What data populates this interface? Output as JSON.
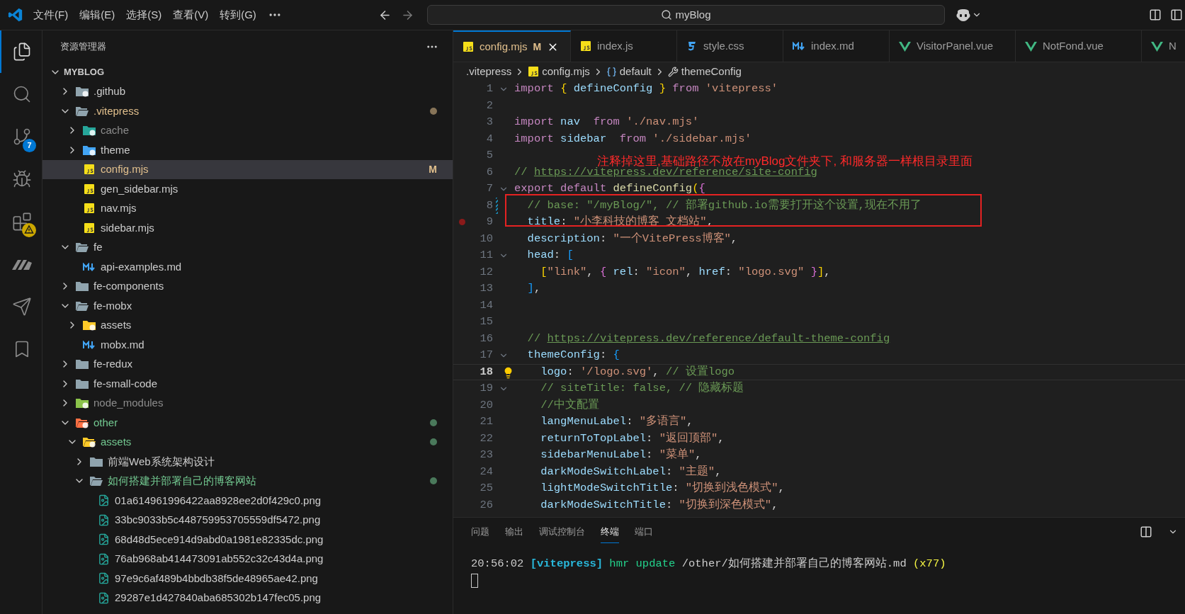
{
  "menu": [
    "文件(F)",
    "编辑(E)",
    "选择(S)",
    "查看(V)",
    "转到(G)"
  ],
  "command_center": {
    "text": "myBlog"
  },
  "activity_bar": [
    {
      "kind": "files",
      "selected": true
    },
    {
      "kind": "search",
      "selected": false
    },
    {
      "kind": "scm",
      "selected": false,
      "badge": "7"
    },
    {
      "kind": "run",
      "selected": false
    },
    {
      "kind": "extensions",
      "selected": false,
      "warning": true
    },
    {
      "kind": "bars",
      "selected": false
    },
    {
      "kind": "send",
      "selected": false
    },
    {
      "kind": "bookmark",
      "selected": false
    }
  ],
  "sidebar": {
    "title": "资源管理器",
    "root": {
      "name": "MYBLOG",
      "expanded": true
    },
    "tree": [
      {
        "name": ".github",
        "kind": "github",
        "color": "#cccccc",
        "expanded": false,
        "selected": false,
        "dot": false
      },
      {
        "name": ".vitepress",
        "kind": "folder",
        "color": "#e2c08d",
        "expanded": true,
        "selected": false,
        "dot": true,
        "children": [
          {
            "name": "cache",
            "kind": "cache",
            "color": "#8c8c8c",
            "expanded": false,
            "selected": false,
            "dot": false
          },
          {
            "name": "theme",
            "kind": "theme",
            "color": "#cccccc",
            "expanded": false,
            "selected": false,
            "dot": false
          },
          {
            "name": "config.mjs",
            "kind": "js",
            "color": "#e2c08d",
            "selected": true,
            "dot": false,
            "badge": "M"
          },
          {
            "name": "gen_sidebar.mjs",
            "kind": "js",
            "color": "#cccccc",
            "selected": false,
            "dot": false
          },
          {
            "name": "nav.mjs",
            "kind": "js",
            "color": "#cccccc",
            "selected": false,
            "dot": false
          },
          {
            "name": "sidebar.mjs",
            "kind": "js",
            "color": "#cccccc",
            "selected": false,
            "dot": false
          }
        ]
      },
      {
        "name": "fe",
        "kind": "folder",
        "color": "#cccccc",
        "expanded": true,
        "selected": false,
        "dot": false,
        "children": [
          {
            "name": "api-examples.md",
            "kind": "md",
            "color": "#cccccc",
            "selected": false,
            "dot": false
          }
        ]
      },
      {
        "name": "fe-components",
        "kind": "folder",
        "color": "#cccccc",
        "expanded": false,
        "selected": false,
        "dot": false
      },
      {
        "name": "fe-mobx",
        "kind": "folder",
        "color": "#cccccc",
        "expanded": true,
        "selected": false,
        "dot": false,
        "children": [
          {
            "name": "assets",
            "kind": "assets",
            "color": "#cccccc",
            "expanded": false,
            "selected": false,
            "dot": false
          },
          {
            "name": "mobx.md",
            "kind": "md",
            "color": "#cccccc",
            "selected": false,
            "dot": false
          }
        ]
      },
      {
        "name": "fe-redux",
        "kind": "folder",
        "color": "#cccccc",
        "expanded": false,
        "selected": false,
        "dot": false
      },
      {
        "name": "fe-small-code",
        "kind": "folder",
        "color": "#cccccc",
        "expanded": false,
        "selected": false,
        "dot": false
      },
      {
        "name": "node_modules",
        "kind": "node",
        "color": "#8c8c8c",
        "expanded": false,
        "selected": false,
        "dot": false
      },
      {
        "name": "other",
        "kind": "other",
        "color": "#73c991",
        "expanded": true,
        "selected": false,
        "dot": true,
        "children": [
          {
            "name": "assets",
            "kind": "assets",
            "color": "#73c991",
            "expanded": true,
            "selected": false,
            "dot": true,
            "children": [
              {
                "name": "前端Web系统架构设计",
                "kind": "folder",
                "color": "#cccccc",
                "expanded": false,
                "selected": false,
                "dot": false
              },
              {
                "name": "如何搭建并部署自己的博客网站",
                "kind": "folder",
                "color": "#73c991",
                "expanded": true,
                "selected": false,
                "dot": true,
                "children": [
                  {
                    "name": "01a614961996422aa8928ee2d0f429c0.png",
                    "kind": "image",
                    "color": "#cccccc",
                    "selected": false,
                    "dot": false
                  },
                  {
                    "name": "33bc9033b5c448759953705559df5472.png",
                    "kind": "image",
                    "color": "#cccccc",
                    "selected": false,
                    "dot": false
                  },
                  {
                    "name": "68d48d5ece914d9abd0a1981e82335dc.png",
                    "kind": "image",
                    "color": "#cccccc",
                    "selected": false,
                    "dot": false
                  },
                  {
                    "name": "76ab968ab414473091ab552c32c43d4a.png",
                    "kind": "image",
                    "color": "#cccccc",
                    "selected": false,
                    "dot": false
                  },
                  {
                    "name": "97e9c6af489b4bbdb38f5de48965ae42.png",
                    "kind": "image",
                    "color": "#cccccc",
                    "selected": false,
                    "dot": false
                  },
                  {
                    "name": "29287e1d427840aba685302b147fec05.png",
                    "kind": "image",
                    "color": "#cccccc",
                    "selected": false,
                    "dot": false
                  }
                ]
              }
            ]
          }
        ]
      }
    ]
  },
  "tabs": [
    {
      "label": "config.mjs",
      "kind": "js",
      "selected": true,
      "badge": "M"
    },
    {
      "label": "index.js",
      "kind": "js",
      "selected": false
    },
    {
      "label": "style.css",
      "kind": "css",
      "selected": false
    },
    {
      "label": "index.md",
      "kind": "md",
      "selected": false
    },
    {
      "label": "VisitorPanel.vue",
      "kind": "vue",
      "selected": false
    },
    {
      "label": "NotFond.vue",
      "kind": "vue",
      "selected": false
    },
    {
      "label": "N",
      "kind": "vue",
      "selected": false
    }
  ],
  "breadcrumbs": [
    {
      "label": ".vitepress",
      "kind": "folder"
    },
    {
      "label": "config.mjs",
      "kind": "js"
    },
    {
      "label": "default",
      "kind": "symbol"
    },
    {
      "label": "themeConfig",
      "kind": "property"
    }
  ],
  "code": [
    {
      "n": "1",
      "fold": true,
      "modified": false,
      "breakpoint": false,
      "lightbulb": false,
      "current": false,
      "tokens": [
        {
          "kind": "kw",
          "t": "import "
        },
        {
          "kind": "b1",
          "t": "{"
        },
        {
          "kind": "id",
          "t": " defineConfig "
        },
        {
          "kind": "b1",
          "t": "}"
        },
        {
          "kind": "kw",
          "t": " from "
        },
        {
          "kind": "str",
          "t": "'vitepress'"
        }
      ]
    },
    {
      "n": "2",
      "fold": false,
      "modified": false,
      "breakpoint": false,
      "lightbulb": false,
      "current": false
    },
    {
      "n": "3",
      "fold": false,
      "modified": false,
      "breakpoint": false,
      "lightbulb": false,
      "current": false,
      "tokens": [
        {
          "kind": "kw",
          "t": "import"
        },
        {
          "kind": "id",
          "t": " nav  "
        },
        {
          "kind": "kw",
          "t": "from "
        },
        {
          "kind": "str",
          "t": "'./nav.mjs'"
        }
      ]
    },
    {
      "n": "4",
      "fold": false,
      "modified": false,
      "breakpoint": false,
      "lightbulb": false,
      "current": false,
      "tokens": [
        {
          "kind": "kw",
          "t": "import"
        },
        {
          "kind": "id",
          "t": " sidebar  "
        },
        {
          "kind": "kw",
          "t": "from "
        },
        {
          "kind": "str",
          "t": "'./sidebar.mjs'"
        }
      ]
    },
    {
      "n": "5",
      "fold": false,
      "modified": false,
      "breakpoint": false,
      "lightbulb": false,
      "current": false
    },
    {
      "n": "6",
      "fold": false,
      "modified": false,
      "breakpoint": false,
      "lightbulb": false,
      "current": false,
      "tokens": [
        {
          "kind": "cm",
          "t": "// "
        },
        {
          "kind": "link",
          "t": "https://vitepress.dev/reference/site-config"
        }
      ]
    },
    {
      "n": "7",
      "fold": true,
      "modified": false,
      "breakpoint": false,
      "lightbulb": false,
      "current": false,
      "tokens": [
        {
          "kind": "kw",
          "t": "export default "
        },
        {
          "kind": "fn",
          "t": "defineConfig"
        },
        {
          "kind": "b1",
          "t": "("
        },
        {
          "kind": "b2",
          "t": "{"
        }
      ]
    },
    {
      "n": "8",
      "fold": false,
      "modified": true,
      "breakpoint": false,
      "lightbulb": false,
      "current": false,
      "tokens": [
        {
          "kind": "cm",
          "t": "  // base: \"/myBlog/\", // 部署github.io需要打开这个设置,现在不用了"
        }
      ]
    },
    {
      "n": "9",
      "fold": false,
      "modified": false,
      "breakpoint": true,
      "lightbulb": false,
      "current": false,
      "tokens": [
        {
          "kind": "id",
          "t": "  title"
        },
        {
          "kind": "p",
          "t": ": "
        },
        {
          "kind": "str",
          "t": "\"小李科技的博客 文档站\""
        },
        {
          "kind": "p",
          "t": ","
        }
      ]
    },
    {
      "n": "10",
      "fold": false,
      "modified": false,
      "breakpoint": false,
      "lightbulb": false,
      "current": false,
      "tokens": [
        {
          "kind": "id",
          "t": "  description"
        },
        {
          "kind": "p",
          "t": ": "
        },
        {
          "kind": "str",
          "t": "\"一个VitePress博客\""
        },
        {
          "kind": "p",
          "t": ","
        }
      ]
    },
    {
      "n": "11",
      "fold": true,
      "modified": false,
      "breakpoint": false,
      "lightbulb": false,
      "current": false,
      "tokens": [
        {
          "kind": "id",
          "t": "  head"
        },
        {
          "kind": "p",
          "t": ": "
        },
        {
          "kind": "b3",
          "t": "["
        }
      ]
    },
    {
      "n": "12",
      "fold": false,
      "modified": false,
      "breakpoint": false,
      "lightbulb": false,
      "current": false,
      "tokens": [
        {
          "kind": "b1",
          "t": "    ["
        },
        {
          "kind": "str",
          "t": "\"link\""
        },
        {
          "kind": "p",
          "t": ", "
        },
        {
          "kind": "b2",
          "t": "{"
        },
        {
          "kind": "id",
          "t": " rel"
        },
        {
          "kind": "p",
          "t": ": "
        },
        {
          "kind": "str",
          "t": "\"icon\""
        },
        {
          "kind": "p",
          "t": ", "
        },
        {
          "kind": "id",
          "t": "href"
        },
        {
          "kind": "p",
          "t": ": "
        },
        {
          "kind": "str",
          "t": "\"logo.svg\""
        },
        {
          "kind": "b2",
          "t": " }"
        },
        {
          "kind": "b1",
          "t": "]"
        },
        {
          "kind": "p",
          "t": ","
        }
      ]
    },
    {
      "n": "13",
      "fold": false,
      "modified": false,
      "breakpoint": false,
      "lightbulb": false,
      "current": false,
      "tokens": [
        {
          "kind": "b3",
          "t": "  ]"
        },
        {
          "kind": "p",
          "t": ","
        }
      ]
    },
    {
      "n": "14",
      "fold": false,
      "modified": false,
      "breakpoint": false,
      "lightbulb": false,
      "current": false
    },
    {
      "n": "15",
      "fold": false,
      "modified": false,
      "breakpoint": false,
      "lightbulb": false,
      "current": false
    },
    {
      "n": "16",
      "fold": false,
      "modified": false,
      "breakpoint": false,
      "lightbulb": false,
      "current": false,
      "tokens": [
        {
          "kind": "cm",
          "t": "  // "
        },
        {
          "kind": "link",
          "t": "https://vitepress.dev/reference/default-theme-config"
        }
      ]
    },
    {
      "n": "17",
      "fold": true,
      "modified": false,
      "breakpoint": false,
      "lightbulb": false,
      "current": false,
      "tokens": [
        {
          "kind": "id",
          "t": "  themeConfig"
        },
        {
          "kind": "p",
          "t": ": "
        },
        {
          "kind": "b3",
          "t": "{"
        }
      ]
    },
    {
      "n": "18",
      "fold": false,
      "modified": false,
      "breakpoint": false,
      "lightbulb": true,
      "current": true,
      "tokens": [
        {
          "kind": "id",
          "t": "    logo"
        },
        {
          "kind": "p",
          "t": ": "
        },
        {
          "kind": "str",
          "t": "'/logo.svg'"
        },
        {
          "kind": "p",
          "t": ", "
        },
        {
          "kind": "cm",
          "t": "// 设置logo"
        }
      ]
    },
    {
      "n": "19",
      "fold": true,
      "modified": false,
      "breakpoint": false,
      "lightbulb": false,
      "current": false,
      "tokens": [
        {
          "kind": "cm",
          "t": "    // siteTitle: false, // 隐藏标题"
        }
      ]
    },
    {
      "n": "20",
      "fold": false,
      "modified": false,
      "breakpoint": false,
      "lightbulb": false,
      "current": false,
      "tokens": [
        {
          "kind": "cm",
          "t": "    //中文配置"
        }
      ]
    },
    {
      "n": "21",
      "fold": false,
      "modified": false,
      "breakpoint": false,
      "lightbulb": false,
      "current": false,
      "tokens": [
        {
          "kind": "id",
          "t": "    langMenuLabel"
        },
        {
          "kind": "p",
          "t": ": "
        },
        {
          "kind": "str",
          "t": "\"多语言\""
        },
        {
          "kind": "p",
          "t": ","
        }
      ]
    },
    {
      "n": "22",
      "fold": false,
      "modified": false,
      "breakpoint": false,
      "lightbulb": false,
      "current": false,
      "tokens": [
        {
          "kind": "id",
          "t": "    returnToTopLabel"
        },
        {
          "kind": "p",
          "t": ": "
        },
        {
          "kind": "str",
          "t": "\"返回顶部\""
        },
        {
          "kind": "p",
          "t": ","
        }
      ]
    },
    {
      "n": "23",
      "fold": false,
      "modified": false,
      "breakpoint": false,
      "lightbulb": false,
      "current": false,
      "tokens": [
        {
          "kind": "id",
          "t": "    sidebarMenuLabel"
        },
        {
          "kind": "p",
          "t": ": "
        },
        {
          "kind": "str",
          "t": "\"菜单\""
        },
        {
          "kind": "p",
          "t": ","
        }
      ]
    },
    {
      "n": "24",
      "fold": false,
      "modified": false,
      "breakpoint": false,
      "lightbulb": false,
      "current": false,
      "tokens": [
        {
          "kind": "id",
          "t": "    darkModeSwitchLabel"
        },
        {
          "kind": "p",
          "t": ": "
        },
        {
          "kind": "str",
          "t": "\"主题\""
        },
        {
          "kind": "p",
          "t": ","
        }
      ]
    },
    {
      "n": "25",
      "fold": false,
      "modified": false,
      "breakpoint": false,
      "lightbulb": false,
      "current": false,
      "tokens": [
        {
          "kind": "id",
          "t": "    lightModeSwitchTitle"
        },
        {
          "kind": "p",
          "t": ": "
        },
        {
          "kind": "str",
          "t": "\"切换到浅色模式\""
        },
        {
          "kind": "p",
          "t": ","
        }
      ]
    },
    {
      "n": "26",
      "fold": false,
      "modified": false,
      "breakpoint": false,
      "lightbulb": false,
      "current": false,
      "tokens": [
        {
          "kind": "id",
          "t": "    darkModeSwitchTitle"
        },
        {
          "kind": "p",
          "t": ": "
        },
        {
          "kind": "str",
          "t": "\"切换到深色模式\""
        },
        {
          "kind": "p",
          "t": ","
        }
      ]
    }
  ],
  "annotation": {
    "text": "注释掉这里,基础路径不放在myBlog文件夹下, 和服务器一样根目录里面"
  },
  "panel": {
    "tabs": [
      {
        "label": "问题",
        "selected": false
      },
      {
        "label": "输出",
        "selected": false
      },
      {
        "label": "调试控制台",
        "selected": false
      },
      {
        "label": "终端",
        "selected": true
      },
      {
        "label": "端口",
        "selected": false
      }
    ],
    "terminal": [
      {
        "kind": "plain",
        "t": "20:56:02 "
      },
      {
        "kind": "tag",
        "t": "[vitepress]"
      },
      {
        "kind": "ok",
        "t": " hmr update"
      },
      {
        "kind": "plain",
        "t": " /other/如何搭建并部署自己的博客网站.md "
      },
      {
        "kind": "count",
        "t": "(x77)"
      }
    ]
  }
}
